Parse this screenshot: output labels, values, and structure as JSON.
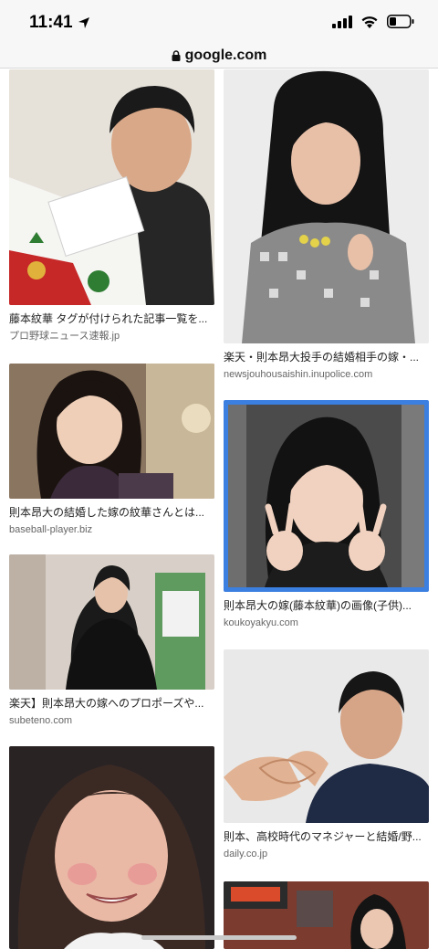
{
  "status": {
    "time": "11:41"
  },
  "url_bar": {
    "domain": "google.com"
  },
  "results": [
    {
      "title": "藤本紋華 タグが付けられた記事一覧を...",
      "source": "プロ野球ニュース速報.jp"
    },
    {
      "title": "楽天・則本昂大投手の結婚相手の嫁・...",
      "source": "newsjouhousaishin.inupolice.com"
    },
    {
      "title": "則本昂大の結婚した嫁の紋華さんとは...",
      "source": "baseball-player.biz"
    },
    {
      "title": "則本昂大の嫁(藤本紋華)の画像(子供)...",
      "source": "koukoyakyu.com"
    },
    {
      "title": "楽天】則本昂大の嫁へのプロポーズや...",
      "source": "subeteno.com"
    },
    {
      "title": "則本、高校時代のマネジャーと結婚/野...",
      "source": "daily.co.jp"
    }
  ],
  "colors": {
    "selected_border": "#3b7fe0"
  }
}
